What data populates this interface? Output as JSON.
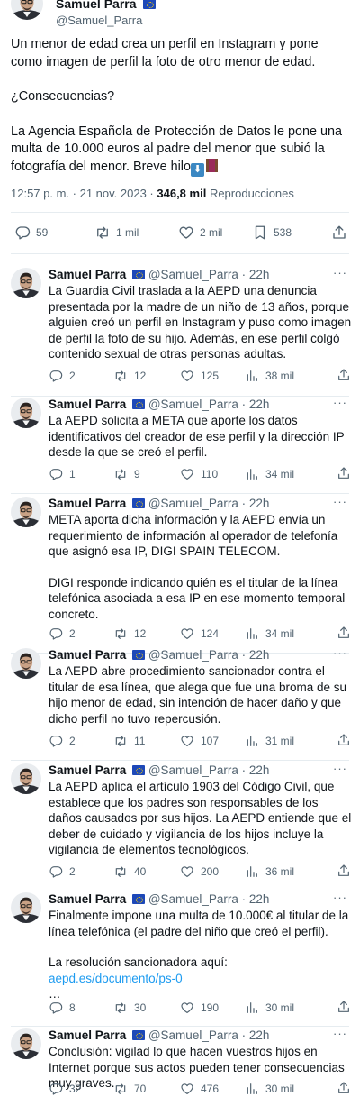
{
  "main_tweet": {
    "display_name": "Samuel Parra",
    "handle": "@Samuel_Parra",
    "paragraphs": [
      "Un menor de edad crea un perfil en Instagram y pone como imagen de perfil la foto de otro menor de edad.",
      "¿Consecuencias?",
      "La Agencia Española de Protección de Datos le pone una multa de 10.000 euros al padre del menor que subió la fotografía del menor. Breve hilo"
    ],
    "emojis": [
      "down-arrow-emoji",
      "thread-spool-emoji"
    ],
    "emoji_glyph": "⬇",
    "timestamp": "12:57 p. m. · 21 nov. 2023 ·",
    "views_count": "346,8 mil",
    "views_label": "Reproducciones",
    "stats": {
      "replies": "59",
      "retweets": "1 mil",
      "likes": "2 mil",
      "bookmarks": "538"
    }
  },
  "replies": [
    {
      "name": "Samuel Parra",
      "meta": "@Samuel_Parra · 22h",
      "paragraphs": [
        "La Guardia Civil traslada a la AEPD una denuncia presentada por la madre de un niño de 13 años, porque alguien creó un perfil en Instagram y puso como imagen de perfil la foto de su hijo. Además, en ese perfil colgó contenido sexual de otras personas adultas."
      ],
      "replies": "2",
      "retweets": "12",
      "likes": "125",
      "views": "38 mil"
    },
    {
      "name": "Samuel Parra",
      "meta": "@Samuel_Parra · 22h",
      "paragraphs": [
        "La AEPD solicita a META que aporte los datos identificativos del creador de ese perfil y la dirección IP desde la que se creó el perfil."
      ],
      "replies": "1",
      "retweets": "9",
      "likes": "110",
      "views": "34 mil"
    },
    {
      "name": "Samuel Parra",
      "meta": "@Samuel_Parra · 22h",
      "paragraphs": [
        "META aporta dicha información y la AEPD envía un requerimiento de información al operador de telefonía que asignó esa IP, DIGI SPAIN TELECOM.",
        "DIGI responde indicando quién es el titular de la línea telefónica asociada a esa IP en ese momento temporal concreto."
      ],
      "replies": "2",
      "retweets": "12",
      "likes": "124",
      "views": "34 mil"
    },
    {
      "name": "Samuel Parra",
      "meta": "@Samuel_Parra · 22h",
      "paragraphs": [
        "La AEPD abre procedimiento sancionador contra el titular de esa línea, que alega que fue una broma de su hijo menor de edad, sin intención de hacer daño y que dicho perfil no tuvo repercusión."
      ],
      "replies": "2",
      "retweets": "11",
      "likes": "107",
      "views": "31 mil"
    },
    {
      "name": "Samuel Parra",
      "meta": "@Samuel_Parra · 22h",
      "paragraphs": [
        "La AEPD aplica el artículo 1903 del Código Civil, que establece que los padres son responsables de los daños causados por sus hijos. La AEPD entiende que el deber de cuidado y vigilancia de los hijos incluye la vigilancia de elementos tecnológicos."
      ],
      "replies": "2",
      "retweets": "40",
      "likes": "200",
      "views": "36 mil"
    },
    {
      "name": "Samuel Parra",
      "meta": "@Samuel_Parra · 22h",
      "paragraphs": [
        "Finalmente impone una multa de 10.000€ al titular de la línea telefónica (el padre del niño que creó el perfil)."
      ],
      "resolution_label": "La resolución sancionadora aquí:",
      "link_text": "aepd.es/documento/ps-0",
      "link_ellipsis": "…",
      "replies": "8",
      "retweets": "30",
      "likes": "190",
      "views": "30 mil"
    },
    {
      "name": "Samuel Parra",
      "meta": "@Samuel_Parra · 22h",
      "paragraphs": [
        "Conclusión: vigilad lo que hacen vuestros hijos en Internet porque sus actos pueden tener consecuencias muy graves."
      ],
      "replies": "32",
      "retweets": "70",
      "likes": "476",
      "views": "30 mil"
    }
  ],
  "more_glyph": "···",
  "colors": {
    "text": "#0f1419",
    "secondary": "#536471",
    "link": "#1d9bf0",
    "divider": "#e6ecf0",
    "verified_eu": "#1d48b8"
  }
}
